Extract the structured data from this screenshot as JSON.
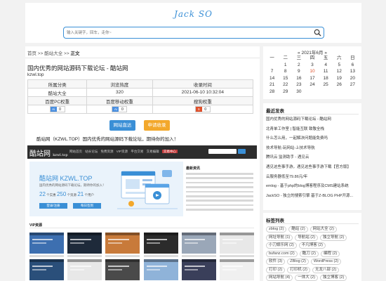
{
  "header": {
    "site_title": "Jack SO",
    "search_placeholder": "输入关键字，回车，走你~"
  },
  "breadcrumb": {
    "home": "首页",
    "sep1": " >> ",
    "category": "酷站大全",
    "sep2": " >> ",
    "current": "正文"
  },
  "article": {
    "title": "国内优秀的网站源码下载论坛 - 酷站网",
    "domain": "kzwl.top",
    "info_table": {
      "headers": [
        "所属分类",
        "浏览热度",
        "收录时间"
      ],
      "values": [
        "酷站大全",
        "320",
        "2021-06-10 10:32:04"
      ],
      "weight_headers": [
        "百度PC权重",
        "百度移动权重",
        "搜狗权重"
      ],
      "weights": [
        {
          "icon_label": "Ai",
          "value": "0",
          "color": "#4a8fe0"
        },
        {
          "icon_label": "Ai",
          "value": "0",
          "color": "#4a8fe0"
        },
        {
          "icon_label": "S",
          "value": "0",
          "color": "#e0502a"
        }
      ]
    },
    "visit_button": "网站直达",
    "submit_button": "申请收录",
    "summary": "酷站网（KZWL.TOP）国内优秀的网站源码下载论坛，期待你的加入！"
  },
  "screenshot": {
    "logo": "酷站网",
    "logo_sub": "kzwl.top",
    "menu": [
      "网站首页",
      "站长论坛",
      "免费资源",
      "VIP资源",
      "平台交易",
      "交易编辑"
    ],
    "menu_active": "交易中心",
    "banner_title": "酷站网  KZWL.TOP",
    "banner_subtitle": "国内优秀的网站源码下载论坛，期待你的加入！",
    "stats_count_1": "22",
    "stats_label_1": "个实惠",
    "stats_count_2": "250",
    "stats_label_2": "个资源",
    "stats_count_3": "21",
    "stats_label_3": "个用户",
    "banner_button_1": "登录/注册",
    "banner_button_2": "每日签到",
    "news_heading": "最新资讯",
    "vip_heading": "VIP资源",
    "thumb_colors": [
      "#3d6fb0",
      "#1e2a3a",
      "#c87a3a",
      "#2b2b2b",
      "#9aa7b8",
      "#e8e8e8",
      "#2a4f7a",
      "#e8e8e8",
      "#4a4a4a",
      "#8fb3d9",
      "#3a3f5a",
      "#f0f0f0"
    ]
  },
  "calendar": {
    "title": "« 2021年6月 »",
    "weekdays": [
      "一",
      "二",
      "三",
      "四",
      "五",
      "六",
      "日"
    ],
    "weeks": [
      [
        "",
        "1",
        "2",
        "3",
        "4",
        "5",
        "6"
      ],
      [
        "7",
        "8",
        "9",
        "10",
        "11",
        "12",
        "13"
      ],
      [
        "14",
        "15",
        "16",
        "17",
        "18",
        "19",
        "20"
      ],
      [
        "21",
        "22",
        "23",
        "24",
        "25",
        "26",
        "27"
      ],
      [
        "28",
        "29",
        "30",
        "",
        "",
        "",
        ""
      ]
    ],
    "today": "10"
  },
  "latest": {
    "title": "最近发表",
    "items": [
      "国内优秀的网站源码下载论坛 - 酷站网",
      "北青单工作室 | 智能互联 致敬全栈",
      "什么怎么用，一起解决问题能免费吗",
      "技术导航-玩网站-上技术导航",
      "腾讯云 监测助手 - 遇见云",
      "遇见这些事手游，遇见这些事手游下载【官方版】",
      "云服务器低至79.86元/年",
      "emlog - 基于php的blog博客程序及CMS建站系统",
      "JackSO - 独立的搜索引擎 基于Z-BLOG PHP开源..."
    ]
  },
  "tags": {
    "title": "标签列表",
    "rows": [
      [
        "zblog (2)",
        "酷站 (2)",
        "网站大全 (2)"
      ],
      [
        "网址导航 (1)",
        "导航站 (2)",
        "独立导航 (2)"
      ],
      [
        "小刀娱乐网 (2)",
        "不凡博客 (2)"
      ],
      [
        "bufanz.com (2)",
        "酷刀 (2)",
        "编程 (2)"
      ],
      [
        "软件 (3)",
        "ZBlog (2)",
        "WordPress (2)"
      ],
      [
        "打印 (2)",
        "打印机 (2)",
        "无龙八部 (2)"
      ],
      [
        "网站导航 (4)",
        "一体大 (2)",
        "独立博客 (2)"
      ]
    ]
  }
}
